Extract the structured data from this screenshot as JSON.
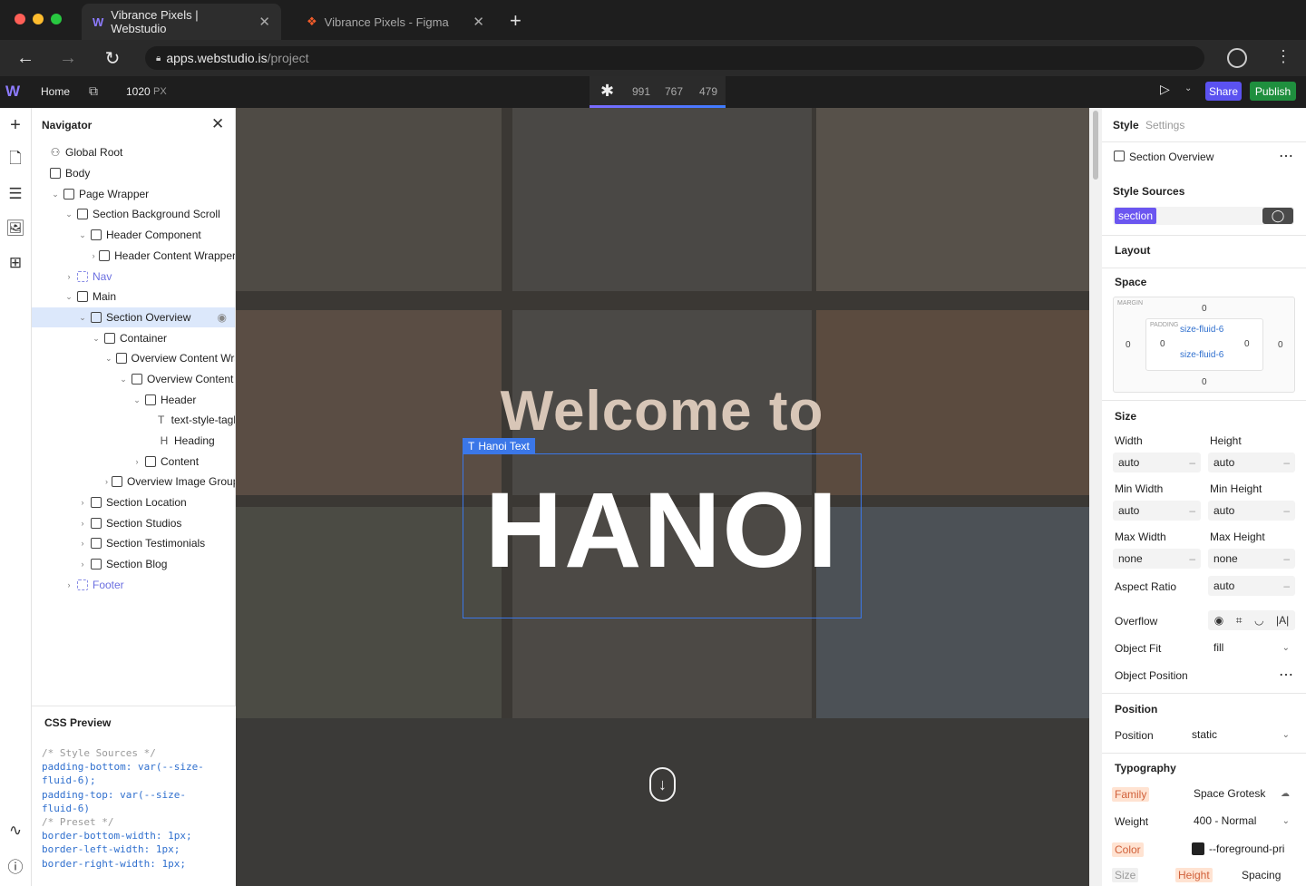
{
  "browser": {
    "tabs": [
      {
        "title": "Vibrance Pixels | Webstudio",
        "active": true
      },
      {
        "title": "Vibrance Pixels - Figma",
        "active": false
      }
    ],
    "url_host": "apps.webstudio.is",
    "url_path": "/project"
  },
  "toolbar": {
    "home_label": "Home",
    "width_value": "1020",
    "width_unit": "PX",
    "breakpoints": [
      "991",
      "767",
      "479"
    ],
    "share_label": "Share",
    "publish_label": "Publish",
    "share_color": "#5b52f0",
    "publish_color": "#1f8f3e"
  },
  "navigator": {
    "title": "Navigator",
    "items": [
      {
        "label": "Global Root",
        "depth": 0,
        "icon": "global-root-icon"
      },
      {
        "label": "Body",
        "depth": 0,
        "icon": "body-icon"
      },
      {
        "label": "Page Wrapper",
        "depth": 1,
        "icon": "box-icon"
      },
      {
        "label": "Section Background Scroll",
        "depth": 2,
        "icon": "box-icon"
      },
      {
        "label": "Header Component",
        "depth": 3,
        "icon": "box-icon"
      },
      {
        "label": "Header Content Wrapper",
        "depth": 4,
        "icon": "box-icon"
      },
      {
        "label": "Nav",
        "depth": 2,
        "icon": "slot-icon"
      },
      {
        "label": "Main",
        "depth": 2,
        "icon": "box-icon"
      },
      {
        "label": "Section Overview",
        "depth": 3,
        "icon": "box-icon",
        "selected": true
      },
      {
        "label": "Container",
        "depth": 4,
        "icon": "box-icon"
      },
      {
        "label": "Overview Content Wra",
        "depth": 5,
        "icon": "box-icon"
      },
      {
        "label": "Overview Content",
        "depth": 6,
        "icon": "box-icon"
      },
      {
        "label": "Header",
        "depth": 7,
        "icon": "box-icon"
      },
      {
        "label": "text-style-tagl",
        "depth": 8,
        "icon": "text-icon"
      },
      {
        "label": "Heading",
        "depth": 8,
        "icon": "heading-icon"
      },
      {
        "label": "Content",
        "depth": 7,
        "icon": "box-icon"
      },
      {
        "label": "Overview Image Group",
        "depth": 5,
        "icon": "box-icon"
      },
      {
        "label": "Section Location",
        "depth": 3,
        "icon": "box-icon"
      },
      {
        "label": "Section Studios",
        "depth": 3,
        "icon": "box-icon"
      },
      {
        "label": "Section Testimonials",
        "depth": 3,
        "icon": "box-icon"
      },
      {
        "label": "Section Blog",
        "depth": 3,
        "icon": "box-icon"
      },
      {
        "label": "Footer",
        "depth": 2,
        "icon": "slot-icon"
      }
    ]
  },
  "css_preview": {
    "title": "CSS Preview",
    "lines": [
      "/* Style Sources */",
      "padding-bottom: var(--size-",
      "fluid-6);",
      "padding-top: var(--size-",
      "fluid-6)",
      "/* Preset */",
      "border-bottom-width: 1px;",
      "border-left-width: 1px;",
      "border-right-width: 1px;"
    ]
  },
  "canvas": {
    "welcome_text": "Welcome to",
    "hanoi_text": "HANOI",
    "selection_label": "Hanoi Text"
  },
  "panel": {
    "tab_style": "Style",
    "tab_settings": "Settings",
    "component_name": "Section Overview",
    "style_sources_title": "Style Sources",
    "source_tag": "section",
    "layout_title": "Layout",
    "space_title": "Space",
    "margin_label": "MARGIN",
    "padding_label": "PADDING",
    "margin": {
      "top": "0",
      "right": "0",
      "bottom": "0",
      "left": "0"
    },
    "padding": {
      "top": "size-fluid-6",
      "right": "0",
      "bottom": "size-fluid-6",
      "left": "0"
    },
    "size_title": "Size",
    "width_label": "Width",
    "width_value": "auto",
    "height_label": "Height",
    "height_value": "auto",
    "min_width_label": "Min Width",
    "min_width_value": "auto",
    "min_height_label": "Min Height",
    "min_height_value": "auto",
    "max_width_label": "Max Width",
    "max_width_value": "none",
    "max_height_label": "Max Height",
    "max_height_value": "none",
    "aspect_ratio_label": "Aspect Ratio",
    "aspect_ratio_value": "auto",
    "overflow_label": "Overflow",
    "object_fit_label": "Object Fit",
    "object_fit_value": "fill",
    "object_position_label": "Object Position",
    "position_title": "Position",
    "position_label": "Position",
    "position_value": "static",
    "typography_title": "Typography",
    "family_label": "Family",
    "family_value": "Space Grotesk",
    "weight_label": "Weight",
    "weight_value": "400 - Normal",
    "color_label": "Color",
    "color_value": "--foreground-pri",
    "size_label": "Size",
    "height_label2": "Height",
    "spacing_label": "Spacing",
    "source_tag_color": "#6b56f0"
  }
}
